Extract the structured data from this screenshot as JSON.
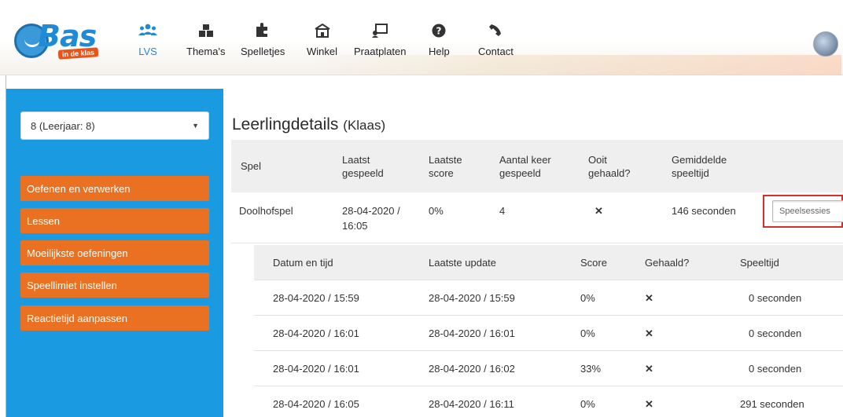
{
  "header": {
    "logo_text": "Bas",
    "logo_tag": "in de klas",
    "nav": [
      {
        "label": "LVS",
        "icon": "users-icon",
        "active": true
      },
      {
        "label": "Thema's",
        "icon": "blocks-icon",
        "active": false
      },
      {
        "label": "Spelletjes",
        "icon": "puzzle-icon",
        "active": false
      },
      {
        "label": "Winkel",
        "icon": "store-icon",
        "active": false
      },
      {
        "label": "Praatplaten",
        "icon": "picture-board-icon",
        "active": false
      },
      {
        "label": "Help",
        "icon": "question-icon",
        "active": false
      },
      {
        "label": "Contact",
        "icon": "phone-icon",
        "active": false
      }
    ],
    "active_color": "#1f8ad6"
  },
  "sidebar": {
    "select_value": "8 (Leerjaar: 8)",
    "buttons": [
      "Oefenen en verwerken",
      "Lessen",
      "Moeilijkste oefeningen",
      "Speellimiet instellen",
      "Reactietijd aanpassen"
    ],
    "bg_color": "#1a9ae0",
    "button_color": "#ea7121"
  },
  "main": {
    "title": "Leerlingdetails",
    "title_sub": "(Klaas)",
    "table": {
      "headers": [
        "Spel",
        "Laatst gespeeld",
        "Laatste score",
        "Aantal keer gespeeld",
        "Ooit gehaald?",
        "Gemiddelde speeltijd"
      ],
      "row": {
        "spel": "Doolhofspel",
        "laatst_gespeeld": "28-04-2020 / 16:05",
        "laatste_score": "0%",
        "aantal": "4",
        "ooit_gehaald": "✕",
        "gemiddelde_speeltijd": "146 seconden",
        "button_label": "Speelsessies"
      }
    },
    "sessions": {
      "headers": [
        "Datum en tijd",
        "Laatste update",
        "Score",
        "Gehaald?",
        "Speeltijd"
      ],
      "rows": [
        [
          "28-04-2020 / 15:59",
          "28-04-2020 / 15:59",
          "0%",
          "✕",
          "0 seconden"
        ],
        [
          "28-04-2020 / 16:01",
          "28-04-2020 / 16:01",
          "0%",
          "✕",
          "0 seconden"
        ],
        [
          "28-04-2020 / 16:01",
          "28-04-2020 / 16:02",
          "33%",
          "✕",
          "0 seconden"
        ],
        [
          "28-04-2020 / 16:05",
          "28-04-2020 / 16:11",
          "0%",
          "✕",
          "291 seconden"
        ]
      ]
    }
  }
}
